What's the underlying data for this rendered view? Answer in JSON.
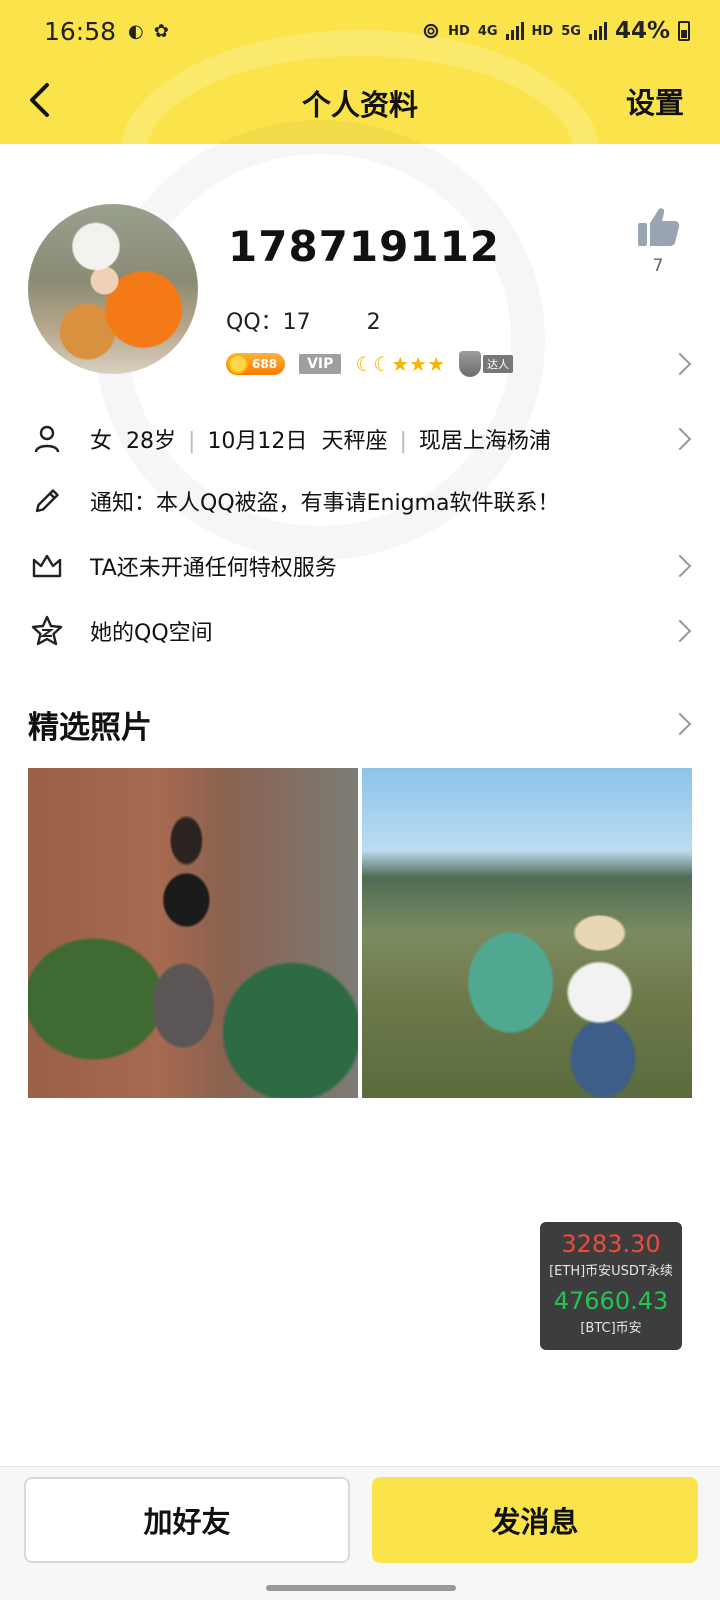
{
  "status_bar": {
    "time": "16:58",
    "network_1": "HD",
    "network_2": "4G",
    "network_3": "HD",
    "network_4": "5G",
    "battery": "44%"
  },
  "header": {
    "title": "个人资料",
    "settings_label": "设置",
    "background_color": "#fbe44b"
  },
  "profile": {
    "nickname": "178719112",
    "qq_label": "QQ：",
    "qq_value": "17        2",
    "coin_value": "688",
    "vip_label": "VIP",
    "level_icons": "☾☾★★★",
    "talent_label": "达人",
    "likes": "7"
  },
  "info_rows": {
    "gender": "女",
    "age": "28岁",
    "birthday": "10月12日",
    "zodiac": "天秤座",
    "location": "现居上海杨浦",
    "notice": "通知：本人QQ被盗，有事请Enigma软件联系！",
    "privilege": "TA还未开通任何特权服务",
    "qzone": "她的QQ空间"
  },
  "photos": {
    "section_title": "精选照片"
  },
  "ticker": {
    "eth_price": "3283.30",
    "eth_label": "[ETH]币安USDT永续",
    "btc_price": "47660.43",
    "btc_label": "[BTC]币安",
    "eth_color": "#f2493a",
    "btc_color": "#23c552"
  },
  "actions": {
    "add_friend": "加好友",
    "send_message": "发消息"
  }
}
